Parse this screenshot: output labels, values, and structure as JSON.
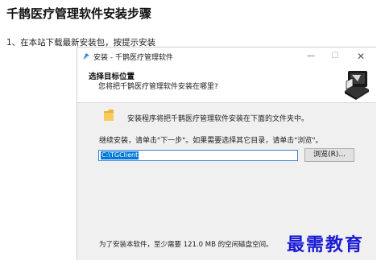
{
  "page": {
    "title": "千鹊医疗管理软件安装步骤",
    "step1": "1、在本站下载最新安装包，按提示安装"
  },
  "dialog": {
    "window_title": "安装 - 千鹊医疗管理软件",
    "header_title": "选择目标位置",
    "header_subtitle": "您将把千鹊医疗管理软件安装在哪里?",
    "info_line": "安装程序将把千鹊医疗管理软件安装在下面的文件夹中。",
    "instruction": "继续安装，请单击\"下一步\"。如果需要选择其它目录，请单击\"浏览\"。",
    "path_value": "C:\\TGClient",
    "browse_label": "浏览(R)...",
    "space_required": "为了安装本软件，至少需要 121.0 MB 的空闲磁盘空间。",
    "controls": {
      "minimize": "—",
      "maximize": "☐",
      "close": "✕"
    }
  },
  "watermark": "最需教育",
  "colors": {
    "watermark": "#1a1ad6",
    "selection": "#0078d7",
    "input_border": "#3c7fd8",
    "dialog_bg": "#f0f0f0"
  }
}
